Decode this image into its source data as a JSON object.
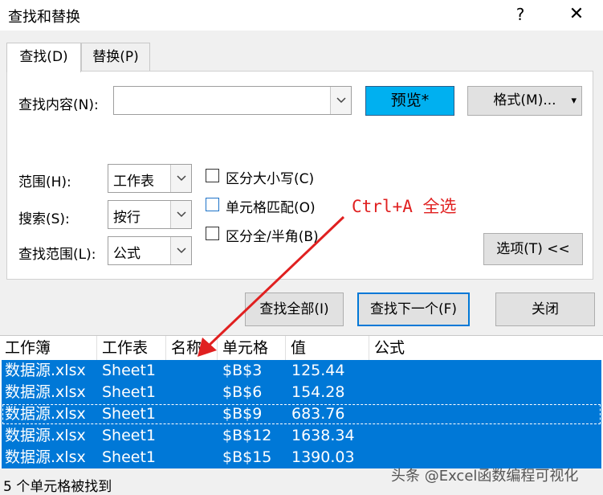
{
  "window": {
    "title": "查找和替换",
    "help": "?",
    "close": "✕"
  },
  "tabs": [
    {
      "label": "查找(D)"
    },
    {
      "label": "替换(P)"
    }
  ],
  "find": {
    "label": "查找内容(N):",
    "value": "",
    "preview_label": "预览*",
    "format_label": "格式(M)...",
    "format_arrow": "▾"
  },
  "options": {
    "scope_label": "范围(H):",
    "scope_value": "工作表",
    "search_label": "搜索(S):",
    "search_value": "按行",
    "lookin_label": "查找范围(L):",
    "lookin_value": "公式",
    "match_case": "区分大小写(C)",
    "match_case_checked": false,
    "match_entire": "单元格匹配(O)",
    "match_entire_checked": false,
    "match_byte": "区分全/半角(B)",
    "match_byte_checked": false,
    "options_button": "选项(T) <<"
  },
  "buttons": {
    "find_all": "查找全部(I)",
    "find_next": "查找下一个(F)",
    "close": "关闭"
  },
  "annotation": {
    "text": "Ctrl+A 全选",
    "color": "#e02020"
  },
  "results": {
    "columns": [
      "工作簿",
      "工作表",
      "名称",
      "单元格",
      "值",
      "公式"
    ],
    "rows": [
      [
        "数据源.xlsx",
        "Sheet1",
        "",
        "$B$3",
        "125.44",
        ""
      ],
      [
        "数据源.xlsx",
        "Sheet1",
        "",
        "$B$6",
        "154.28",
        ""
      ],
      [
        "数据源.xlsx",
        "Sheet1",
        "",
        "$B$9",
        "683.76",
        ""
      ],
      [
        "数据源.xlsx",
        "Sheet1",
        "",
        "$B$12",
        "1638.34",
        ""
      ],
      [
        "数据源.xlsx",
        "Sheet1",
        "",
        "$B$15",
        "1390.03",
        ""
      ]
    ],
    "selection_color": "#0078d7"
  },
  "status": "5 个单元格被找到",
  "watermark": "头条 @Excel函数编程可视化",
  "colors": {
    "preview_button": "#00b0f0",
    "focus_border": "#0078d7"
  }
}
